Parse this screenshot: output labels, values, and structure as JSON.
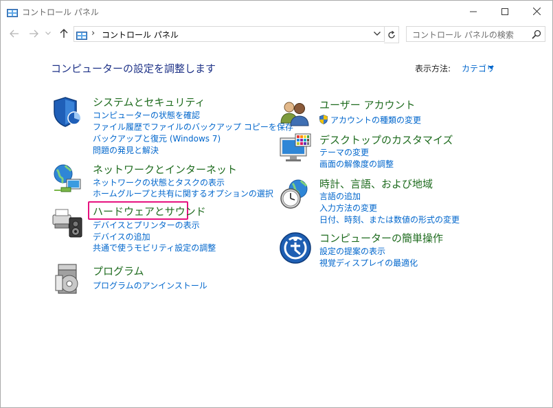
{
  "window": {
    "title": "コントロール パネル"
  },
  "address": {
    "separator": "›",
    "path": "コントロール パネル"
  },
  "search": {
    "placeholder": "コントロール パネルの検索"
  },
  "main": {
    "heading": "コンピューターの設定を調整します",
    "view_by_label": "表示方法:",
    "view_by_value": "カテゴリ"
  },
  "categories": [
    {
      "title": "システムとセキュリティ",
      "icon": "shield-icon",
      "links": [
        "コンピューターの状態を確認",
        "ファイル履歴でファイルのバックアップ コピーを保存",
        "バックアップと復元 (Windows 7)",
        "問題の発見と解決"
      ]
    },
    {
      "title": "ネットワークとインターネット",
      "icon": "network-globe-icon",
      "links": [
        "ネットワークの状態とタスクの表示",
        "ホームグループと共有に関するオプションの選択"
      ]
    },
    {
      "title": "ハードウェアとサウンド",
      "icon": "printer-speaker-icon",
      "links": [
        "デバイスとプリンターの表示",
        "デバイスの追加",
        "共通で使うモビリティ設定の調整"
      ]
    },
    {
      "title": "プログラム",
      "icon": "programs-disc-icon",
      "links": [
        "プログラムのアンインストール"
      ]
    },
    {
      "title": "ユーザー アカウント",
      "icon": "users-icon",
      "links": [
        "アカウントの種類の変更"
      ]
    },
    {
      "title": "デスクトップのカスタマイズ",
      "icon": "monitor-palette-icon",
      "links": [
        "テーマの変更",
        "画面の解像度の調整"
      ]
    },
    {
      "title": "時計、言語、および地域",
      "icon": "clock-globe-icon",
      "links": [
        "言語の追加",
        "入力方法の変更",
        "日付、時刻、または数値の形式の変更"
      ]
    },
    {
      "title": "コンピューターの簡単操作",
      "icon": "ease-of-access-icon",
      "links": [
        "設定の提案の表示",
        "視覚ディスプレイの最適化"
      ]
    }
  ],
  "colors": {
    "heading": "#1e3287",
    "category_title": "#1e6b1e",
    "link": "#0066cc",
    "highlight": "#e6127f"
  }
}
